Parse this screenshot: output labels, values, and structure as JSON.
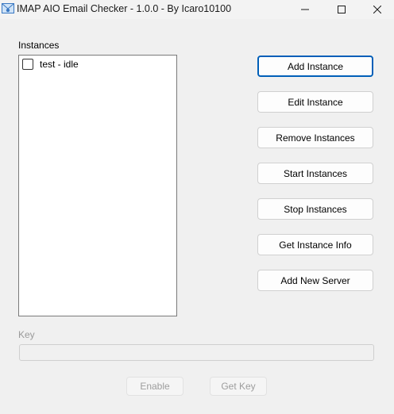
{
  "window": {
    "title": "IMAP AIO Email Checker - 1.0.0 - By Icaro10100",
    "icon": "envelope-icon"
  },
  "instances": {
    "label": "Instances",
    "items": [
      {
        "label": "test - idle",
        "checked": false
      }
    ]
  },
  "buttons": {
    "add_instance": "Add Instance",
    "edit_instance": "Edit Instance",
    "remove_instances": "Remove Instances",
    "start_instances": "Start Instances",
    "stop_instances": "Stop Instances",
    "get_instance_info": "Get Instance Info",
    "add_new_server": "Add New Server"
  },
  "key": {
    "label": "Key",
    "value": "",
    "enable_label": "Enable",
    "get_key_label": "Get Key"
  },
  "colors": {
    "background": "#f0f0f0",
    "focus_border": "#005fb8",
    "disabled_text": "#9d9d9d"
  }
}
